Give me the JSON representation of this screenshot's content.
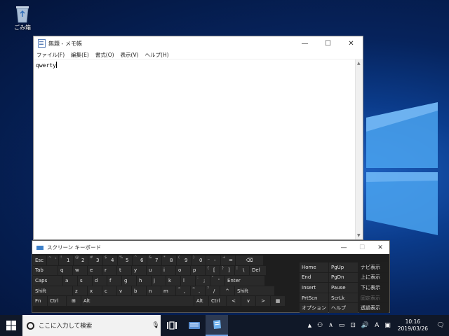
{
  "desktop": {
    "recycle_bin_label": "ごみ箱"
  },
  "notepad": {
    "title": "無題 - メモ帳",
    "menu": [
      "ファイル(F)",
      "編集(E)",
      "書式(O)",
      "表示(V)",
      "ヘルプ(H)"
    ],
    "text": "qwerty",
    "controls": {
      "minimize": "—",
      "maximize": "☐",
      "close": "✕"
    }
  },
  "osk": {
    "title": "スクリーン キーボード",
    "controls": {
      "minimize": "—",
      "maximize": "☐",
      "close": "✕"
    },
    "rows": [
      [
        {
          "m": "Esc",
          "w": 19
        },
        {
          "s": "~",
          "m": "`",
          "w": 16
        },
        {
          "s": "!",
          "m": "1",
          "w": 20
        },
        {
          "s": "@",
          "m": "2",
          "w": 20
        },
        {
          "s": "#",
          "m": "3",
          "w": 20
        },
        {
          "s": "$",
          "m": "4",
          "w": 20
        },
        {
          "s": "%",
          "m": "5",
          "w": 20
        },
        {
          "s": "^",
          "m": "6",
          "w": 20
        },
        {
          "s": "&",
          "m": "7",
          "w": 20
        },
        {
          "s": "*",
          "m": "8",
          "w": 20
        },
        {
          "s": "(",
          "m": "9",
          "w": 20
        },
        {
          "s": ")",
          "m": "0",
          "w": 20
        },
        {
          "s": "_",
          "m": "-",
          "w": 20
        },
        {
          "s": "+",
          "m": "=",
          "w": 20
        },
        {
          "m": "⌫",
          "w": 39,
          "c": true
        }
      ],
      [
        {
          "m": "Tab",
          "w": 35
        },
        {
          "m": "q",
          "w": 20
        },
        {
          "m": "w",
          "w": 20
        },
        {
          "m": "e",
          "w": 20
        },
        {
          "m": "r",
          "w": 20
        },
        {
          "m": "t",
          "w": 20
        },
        {
          "m": "y",
          "w": 20
        },
        {
          "m": "u",
          "w": 20
        },
        {
          "m": "i",
          "w": 20
        },
        {
          "m": "o",
          "w": 20
        },
        {
          "m": "p",
          "w": 20
        },
        {
          "s": "{",
          "m": "[",
          "w": 20
        },
        {
          "s": "}",
          "m": "]",
          "w": 20
        },
        {
          "s": "|",
          "m": "\\",
          "w": 20
        },
        {
          "m": "Del",
          "w": 23
        }
      ],
      [
        {
          "m": "Caps",
          "w": 42
        },
        {
          "m": "a",
          "w": 20
        },
        {
          "m": "s",
          "w": 20
        },
        {
          "m": "d",
          "w": 20
        },
        {
          "m": "f",
          "w": 20
        },
        {
          "m": "g",
          "w": 20
        },
        {
          "m": "h",
          "w": 20
        },
        {
          "m": "j",
          "w": 20
        },
        {
          "m": "k",
          "w": 20
        },
        {
          "m": "l",
          "w": 20
        },
        {
          "s": ":",
          "m": ";",
          "w": 20
        },
        {
          "s": "\"",
          "m": "'",
          "w": 20
        },
        {
          "m": "Enter",
          "w": 56
        }
      ],
      [
        {
          "m": "Shift",
          "w": 56
        },
        {
          "m": "z",
          "w": 20
        },
        {
          "m": "x",
          "w": 20
        },
        {
          "m": "c",
          "w": 20
        },
        {
          "m": "v",
          "w": 20
        },
        {
          "m": "b",
          "w": 20
        },
        {
          "m": "n",
          "w": 20
        },
        {
          "m": "m",
          "w": 20
        },
        {
          "s": "<",
          "m": ",",
          "w": 20
        },
        {
          "s": ">",
          "m": ".",
          "w": 20
        },
        {
          "s": "?",
          "m": "/",
          "w": 20
        },
        {
          "m": "^",
          "w": 20,
          "c": true
        },
        {
          "m": "Shift",
          "w": 56
        }
      ],
      [
        {
          "m": "Fn",
          "w": 20
        },
        {
          "m": "Ctrl",
          "w": 26
        },
        {
          "m": "⊞",
          "w": 20,
          "c": true
        },
        {
          "m": "Alt",
          "w": 160
        },
        {
          "m": "Alt",
          "w": 20
        },
        {
          "m": "Ctrl",
          "w": 24
        },
        {
          "m": "<",
          "w": 20,
          "c": true
        },
        {
          "m": "∨",
          "w": 20,
          "c": true
        },
        {
          "m": ">",
          "w": 20,
          "c": true
        },
        {
          "m": "▦",
          "w": 20,
          "c": true
        }
      ]
    ],
    "nav": [
      [
        {
          "m": "Home"
        },
        {
          "m": "PgUp"
        },
        {
          "m": "ナビ表示",
          "w": true
        }
      ],
      [
        {
          "m": "End"
        },
        {
          "m": "PgDn"
        },
        {
          "m": "上に表示",
          "w": true
        }
      ],
      [
        {
          "m": "Insert"
        },
        {
          "m": "Pause"
        },
        {
          "m": "下に表示",
          "w": true
        }
      ],
      [
        {
          "m": "PrtScn"
        },
        {
          "m": "ScrLk"
        },
        {
          "m": "固定表示",
          "w": true,
          "dim": true
        }
      ],
      [
        {
          "m": "オプション"
        },
        {
          "m": "ヘルプ"
        },
        {
          "m": "透過表示",
          "w": true
        }
      ]
    ]
  },
  "taskbar": {
    "search_placeholder": "ここに入力して検索",
    "tray_ime": "A",
    "time": "10:16",
    "date": "2019/03/26"
  }
}
